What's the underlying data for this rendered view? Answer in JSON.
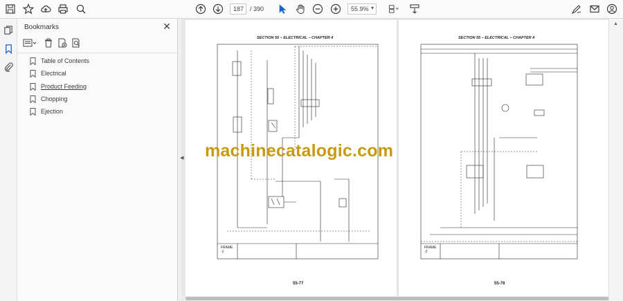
{
  "toolbar": {
    "page_current": "187",
    "page_total": "/ 390",
    "zoom": "55.9%"
  },
  "bookmarks_panel": {
    "title": "Bookmarks",
    "items": [
      {
        "label": "Table of Contents"
      },
      {
        "label": "Electrical"
      },
      {
        "label": "Product Feeding"
      },
      {
        "label": "Chopping"
      },
      {
        "label": "Ejection"
      }
    ]
  },
  "document": {
    "left_page": {
      "section_header": "SECTION 55 – ELECTRICAL – CHAPTER 4",
      "page_number": "55-77",
      "frame_label": "FRAME\n-1"
    },
    "right_page": {
      "section_header": "SECTION 55 – ELECTRICAL – CHAPTER 4",
      "page_number": "55-78",
      "frame_label": "FRAME\n-2"
    },
    "watermark": "machinecatalogic.com"
  },
  "colors": {
    "watermark": "#c79a10",
    "icon": "#3a3a3a"
  }
}
